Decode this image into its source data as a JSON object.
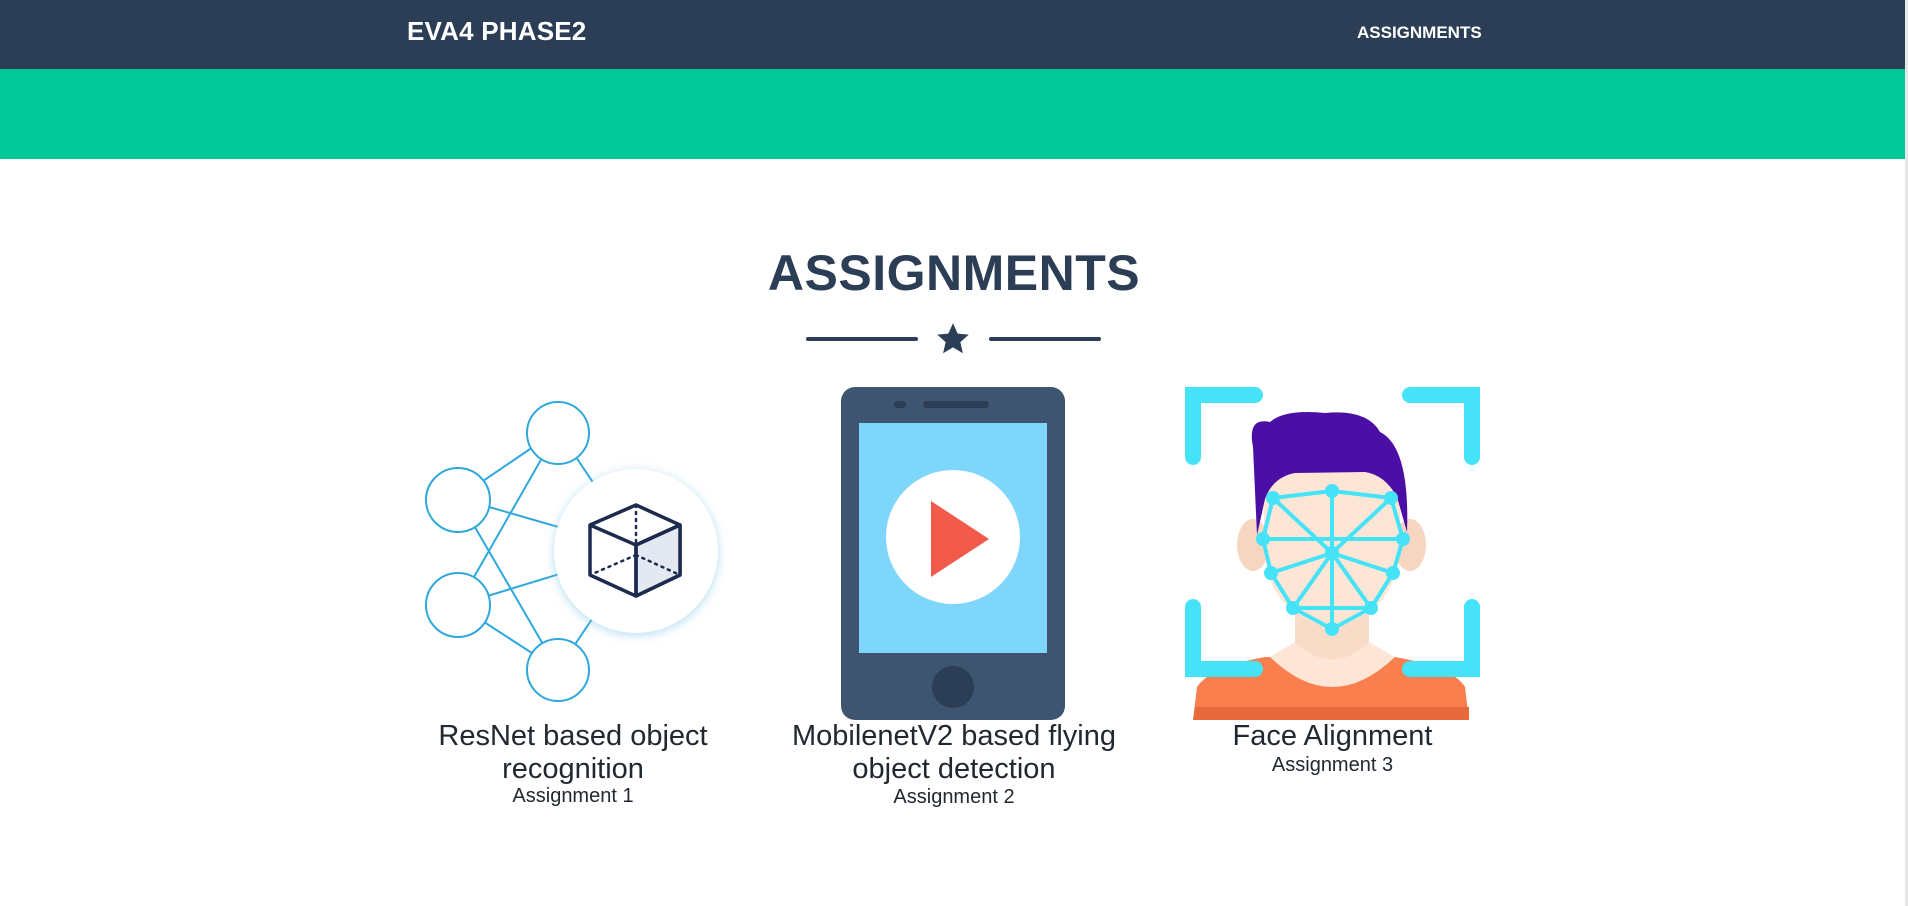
{
  "navbar": {
    "brand": "EVA4 PHASE2",
    "links": [
      "ASSIGNMENTS"
    ]
  },
  "section": {
    "title": "ASSIGNMENTS",
    "divider_icon": "star-icon"
  },
  "assignments": [
    {
      "title": "ResNet based object recognition",
      "subtitle": "Assignment 1",
      "icon": "neural-network-cube-icon"
    },
    {
      "title": "MobilenetV2 based flying object detection",
      "subtitle": "Assignment 2",
      "icon": "phone-play-icon"
    },
    {
      "title": "Face Alignment",
      "subtitle": "Assignment 3",
      "icon": "face-landmarks-icon"
    }
  ],
  "colors": {
    "navbar": "#2c3e55",
    "accent_band": "#00c897",
    "heading": "#2c3e55"
  }
}
